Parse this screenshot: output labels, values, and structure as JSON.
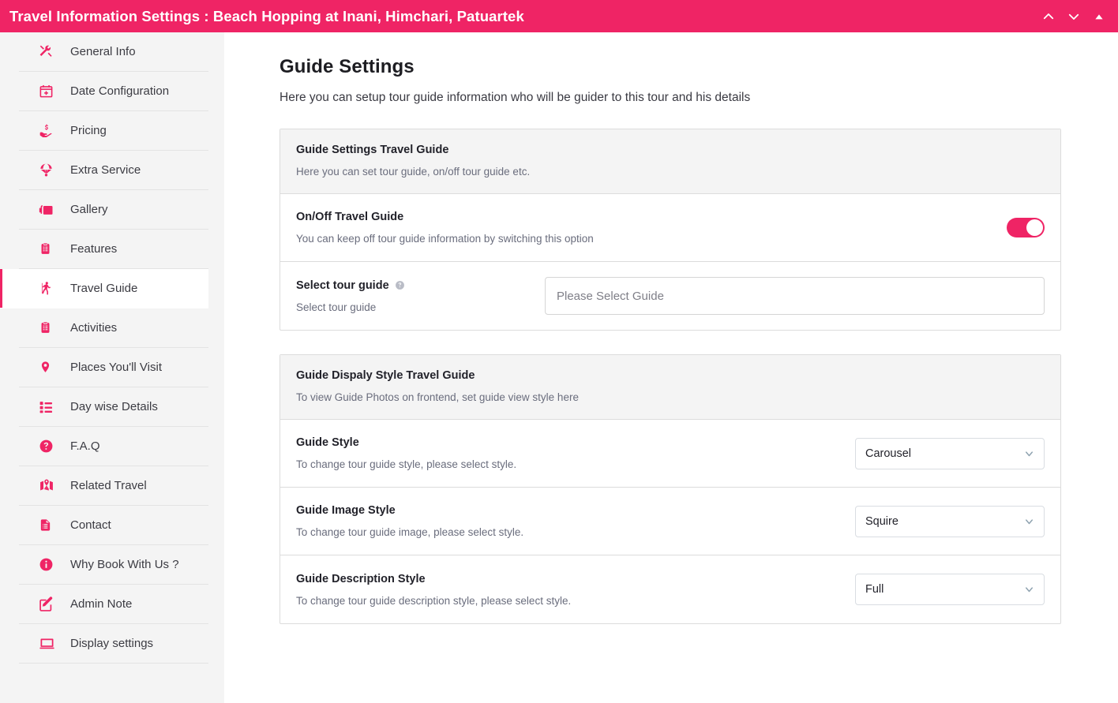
{
  "topbar": {
    "title": "Travel Information Settings : Beach Hopping at Inani, Himchari, Patuartek",
    "accent_color": "#ef2465",
    "actions": [
      {
        "name": "chevron-up-icon",
        "label": "Collapse"
      },
      {
        "name": "chevron-down-icon",
        "label": "Expand"
      },
      {
        "name": "triangle-up-icon",
        "label": "Scroll to top"
      }
    ]
  },
  "sidebar": {
    "items": [
      {
        "label": "General Info",
        "icon": "tools-icon",
        "active": false
      },
      {
        "label": "Date Configuration",
        "icon": "calendar-plus-icon",
        "active": false
      },
      {
        "label": "Pricing",
        "icon": "hand-money-icon",
        "active": false
      },
      {
        "label": "Extra Service",
        "icon": "parachute-icon",
        "active": false
      },
      {
        "label": "Gallery",
        "icon": "images-icon",
        "active": false
      },
      {
        "label": "Features",
        "icon": "clipboard-icon",
        "active": false
      },
      {
        "label": "Travel Guide",
        "icon": "hiker-icon",
        "active": true
      },
      {
        "label": "Activities",
        "icon": "clipboard-icon",
        "active": false
      },
      {
        "label": "Places You'll Visit",
        "icon": "map-pin-icon",
        "active": false
      },
      {
        "label": "Day wise Details",
        "icon": "list-icon",
        "active": false
      },
      {
        "label": "F.A.Q",
        "icon": "question-circle-icon",
        "active": false
      },
      {
        "label": "Related Travel",
        "icon": "map-marked-icon",
        "active": false
      },
      {
        "label": "Contact",
        "icon": "document-icon",
        "active": false
      },
      {
        "label": "Why Book With Us ?",
        "icon": "info-circle-icon",
        "active": false
      },
      {
        "label": "Admin Note",
        "icon": "edit-square-icon",
        "active": false
      },
      {
        "label": "Display settings",
        "icon": "monitor-icon",
        "active": false
      }
    ]
  },
  "main": {
    "title": "Guide Settings",
    "subtitle": "Here you can setup tour guide information who will be guider to this tour and his details",
    "cards": [
      {
        "head_title": "Guide Settings Travel Guide",
        "head_sub": "Here you can set tour guide, on/off tour guide etc.",
        "rows": [
          {
            "title": "On/Off Travel Guide",
            "sub": "You can keep off tour guide information by switching this option",
            "control": "toggle",
            "toggle_on": true
          },
          {
            "title": "Select tour guide",
            "has_help": true,
            "sub": "Select tour guide",
            "control": "input",
            "placeholder": "Please Select Guide",
            "value": ""
          }
        ]
      },
      {
        "head_title": "Guide Dispaly Style Travel Guide",
        "head_sub": "To view Guide Photos on frontend, set guide view style here",
        "rows": [
          {
            "title": "Guide Style",
            "sub": "To change tour guide style, please select style.",
            "control": "select",
            "value": "Carousel"
          },
          {
            "title": "Guide Image Style",
            "sub": "To change tour guide image, please select style.",
            "control": "select",
            "value": "Squire"
          },
          {
            "title": "Guide Description Style",
            "sub": "To change tour guide description style, please select style.",
            "control": "select",
            "value": "Full"
          }
        ]
      }
    ]
  }
}
